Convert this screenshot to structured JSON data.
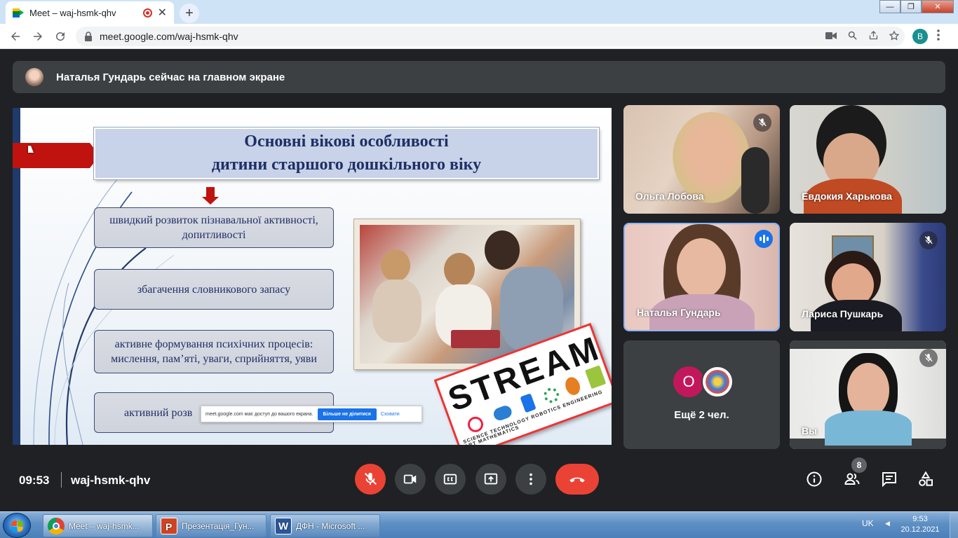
{
  "browser": {
    "tab_title": "Meet – waj-hsmk-qhv",
    "new_tab_label": "+",
    "tab_close": "✕",
    "url": "meet.google.com/waj-hsmk-qhv",
    "profile_initial": "B",
    "window_controls": {
      "minimize": "—",
      "maximize": "❐",
      "close": "✕"
    }
  },
  "banner": {
    "text": "Наталья Гундарь сейчас на главном экране"
  },
  "slide": {
    "title_line1": "Основні вікові особливості",
    "title_line2": "дитини старшого дошкільного віку",
    "boxes": [
      "швидкий розвиток пізнавальної активності, допитливості",
      "збагачення словникового запасу",
      "активне формування психічних процесів: мислення, пам’яті, уваги, сприйняття, уяви",
      "активний розв"
    ],
    "stream_word": "STREAM",
    "stream_labels": "SCIENCE  TECHNOLOGY  ROBOTICS  ENGINEERING  ART  MATHEMATICS",
    "share_popup": {
      "text": "meet.google.com має доступ до вашого екрана.",
      "stop_label": "Більше не ділитися",
      "hide_label": "Сховати"
    }
  },
  "participants": [
    {
      "name": "Ольга Лобова",
      "muted": true
    },
    {
      "name": "Евдокия Харькова",
      "muted": false
    },
    {
      "name": "Наталья Гундарь",
      "speaking": true
    },
    {
      "name": "Лариса Пушкарь",
      "muted": true
    },
    {
      "name": "Ещё 2 чел.",
      "initial": "О"
    },
    {
      "name": "Вы",
      "muted": true
    }
  ],
  "controls": {
    "time": "09:53",
    "meeting_code": "waj-hsmk-qhv",
    "people_count": "8"
  },
  "taskbar": {
    "items": [
      "Meet – waj-hsmk...",
      "Презентація_Гун...",
      "ДФН - Microsoft ..."
    ],
    "lang": "UK",
    "tray_arrow": "◀",
    "time": "9:53",
    "date": "20.12.2021"
  },
  "colors": {
    "accent": "#1a73e8",
    "danger": "#ea4335",
    "meet_bg": "#202124",
    "tile_bg": "#3c4043"
  }
}
